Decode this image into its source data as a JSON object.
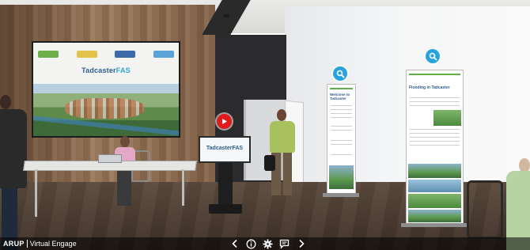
{
  "brand": {
    "company": "ARUP",
    "product": "Virtual Engage"
  },
  "wall_screen": {
    "title_main": "Tadcaster",
    "title_accent": "FAS"
  },
  "kiosk": {
    "title": "TadcasterFAS"
  },
  "banners": [
    {
      "heading": "Welcome to Tadcaster"
    },
    {
      "heading": "Flooding in Tadcaster"
    }
  ],
  "hotspots": {
    "video": "play-video",
    "info": [
      "banner-1-zoom",
      "banner-2-zoom"
    ]
  },
  "toolbar": {
    "icons": [
      "chevron-left-icon",
      "info-icon",
      "gear-icon",
      "chat-icon",
      "chevron-right-icon"
    ]
  },
  "colors": {
    "hotspot_blue": "#29a3de",
    "play_red": "#e11b1b",
    "brand_blue": "#2b5d8f",
    "accent_green": "#5fae4a"
  }
}
